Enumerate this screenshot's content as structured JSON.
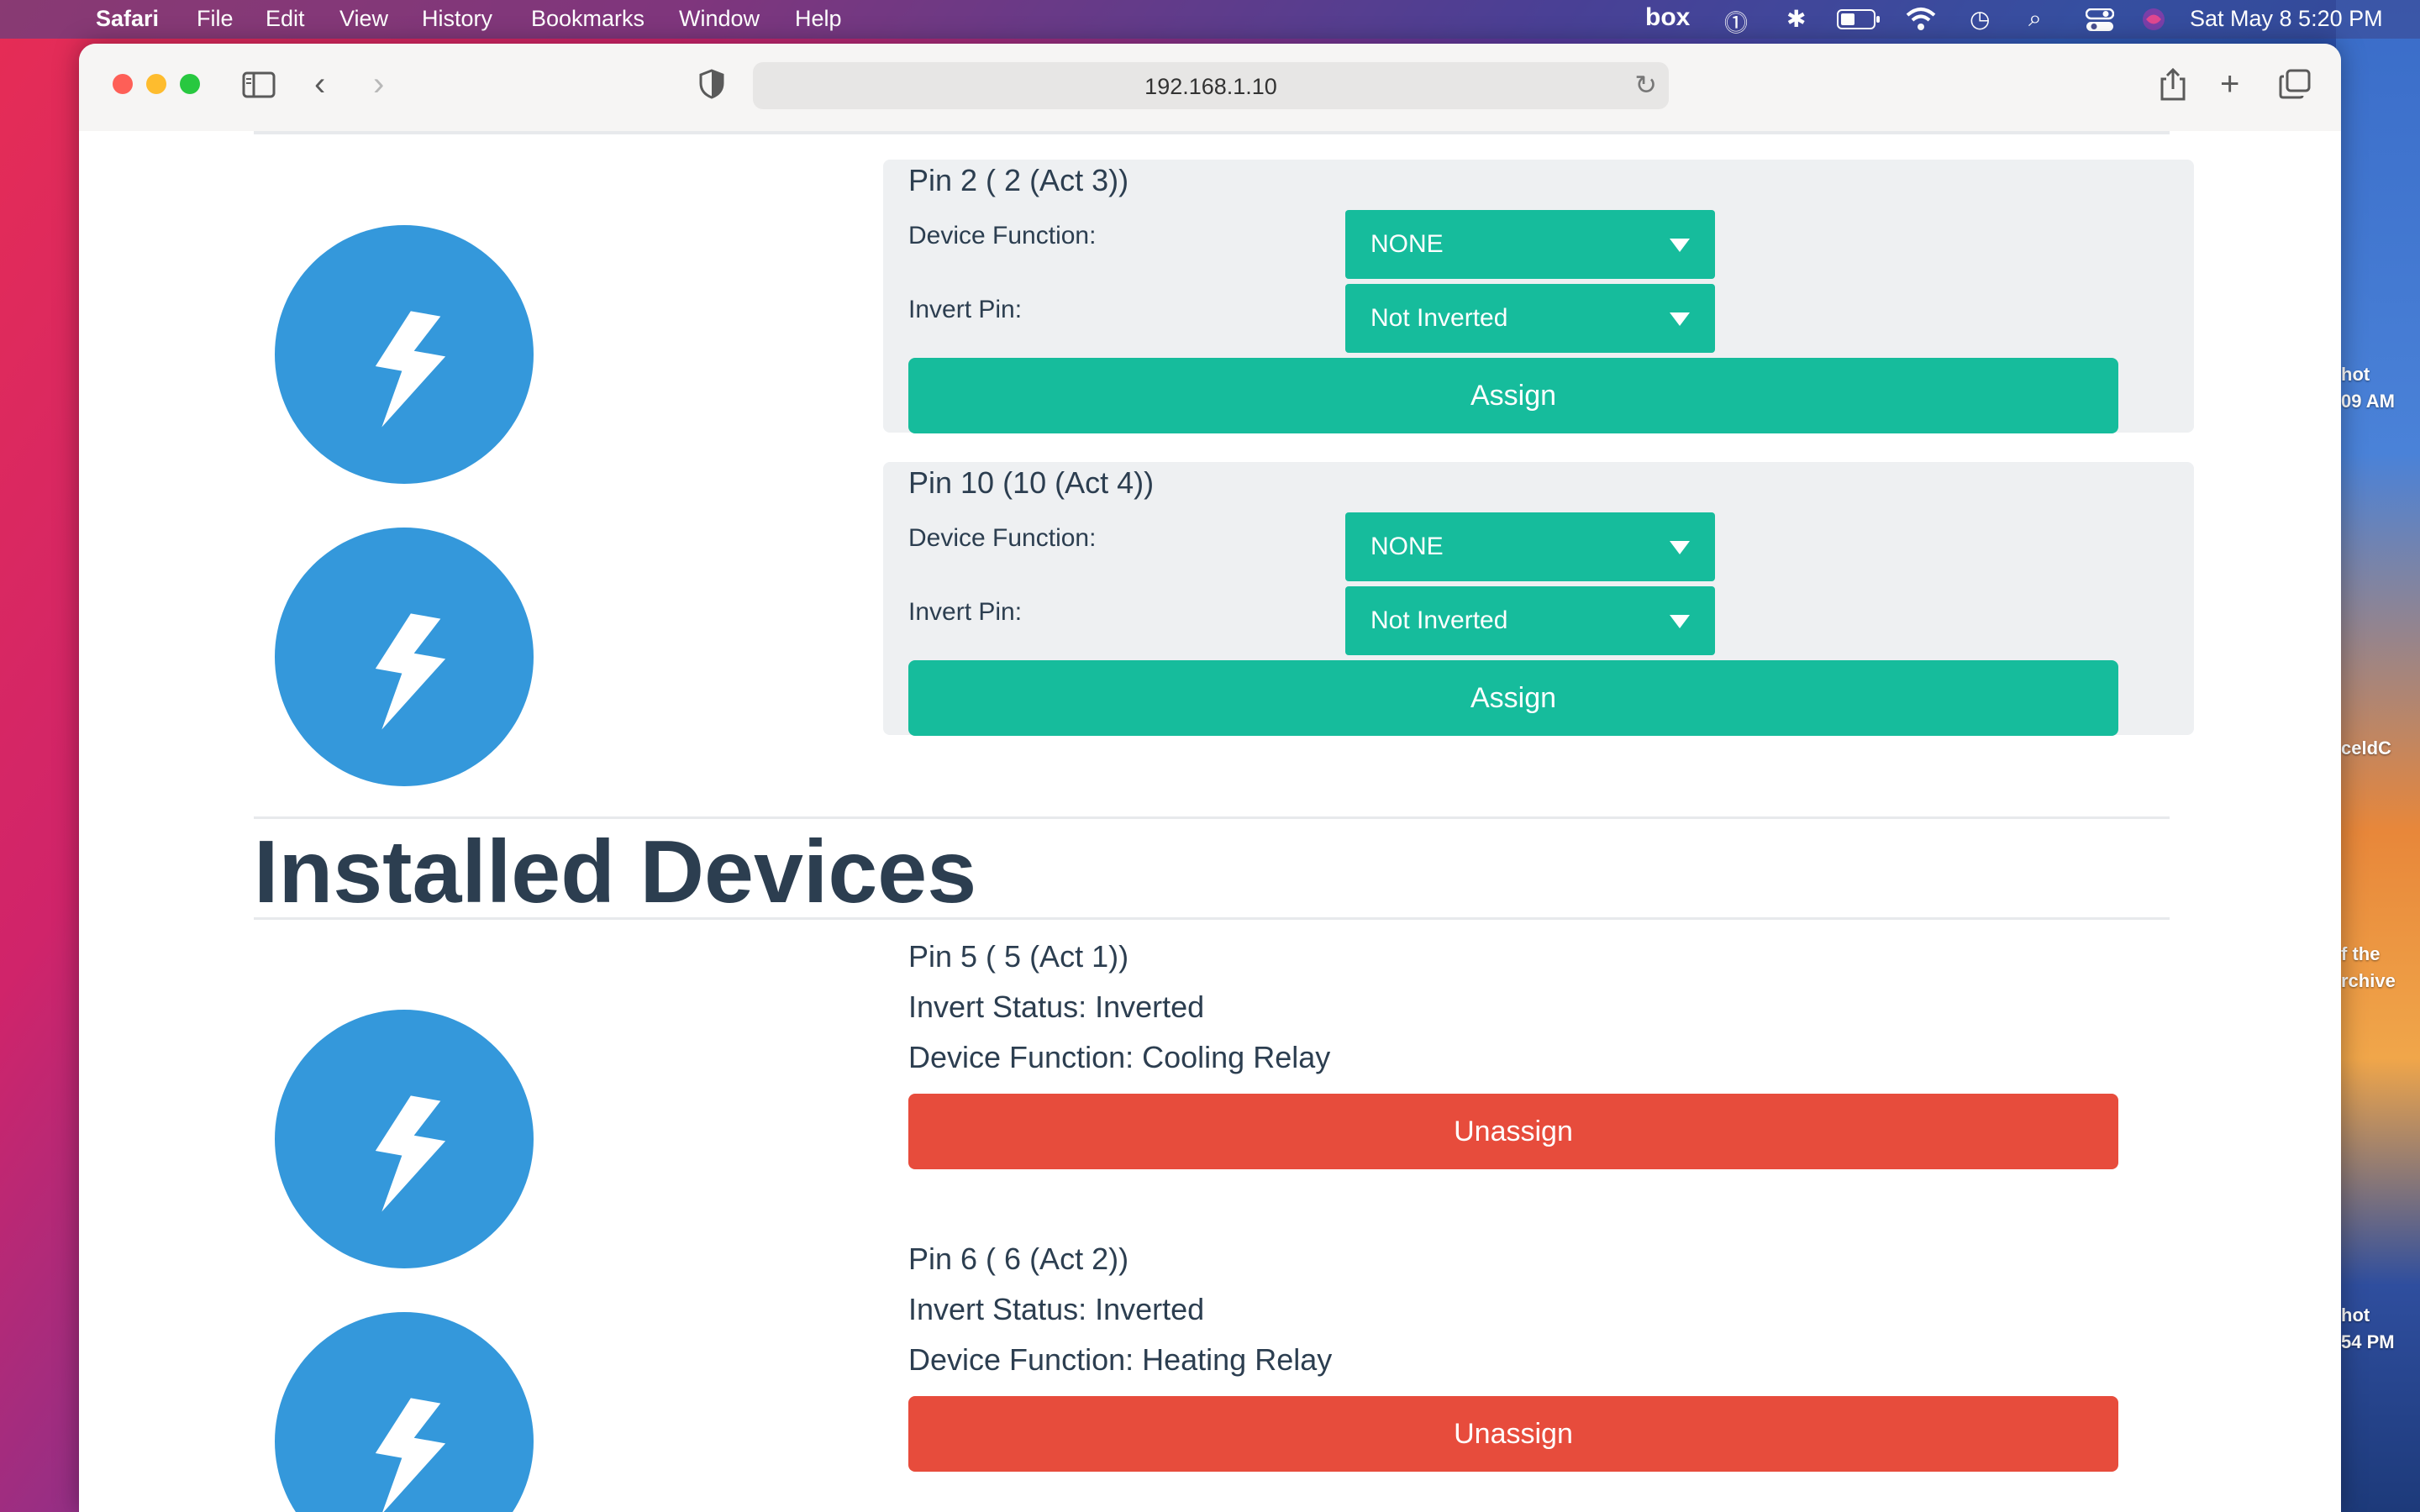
{
  "menubar": {
    "app": "Safari",
    "items": [
      "File",
      "Edit",
      "View",
      "History",
      "Bookmarks",
      "Window",
      "Help"
    ],
    "box_label": "box",
    "clock": "Sat May 8  5:20 PM"
  },
  "desktop": {
    "labels": [
      "hot\n09 AM",
      "celdC",
      "f the\nrchive",
      "hot\n54 PM"
    ]
  },
  "browser": {
    "url": "192.168.1.10"
  },
  "pin_cards": [
    {
      "title": "Pin 2 ( 2 (Act 3))",
      "device_function_label": "Device Function:",
      "device_function_value": "NONE",
      "invert_label": "Invert Pin:",
      "invert_value": "Not Inverted",
      "button": "Assign"
    },
    {
      "title": "Pin 10 (10 (Act 4))",
      "device_function_label": "Device Function:",
      "device_function_value": "NONE",
      "invert_label": "Invert Pin:",
      "invert_value": "Not Inverted",
      "button": "Assign"
    }
  ],
  "installed": {
    "heading": "Installed Devices",
    "devices": [
      {
        "title": "Pin 5 ( 5 (Act 1))",
        "invert_status": "Invert Status: Inverted",
        "device_function": "Device Function: Cooling Relay",
        "button": "Unassign"
      },
      {
        "title": "Pin 6 ( 6 (Act 2))",
        "invert_status": "Invert Status: Inverted",
        "device_function": "Device Function: Heating Relay",
        "button": "Unassign"
      }
    ]
  },
  "colors": {
    "accent_green": "#16bc9c",
    "danger_red": "#e74c3c",
    "icon_blue": "#3498db",
    "text_dark": "#2c3e50"
  },
  "icons": {
    "device": "lightning-bolt-icon"
  }
}
